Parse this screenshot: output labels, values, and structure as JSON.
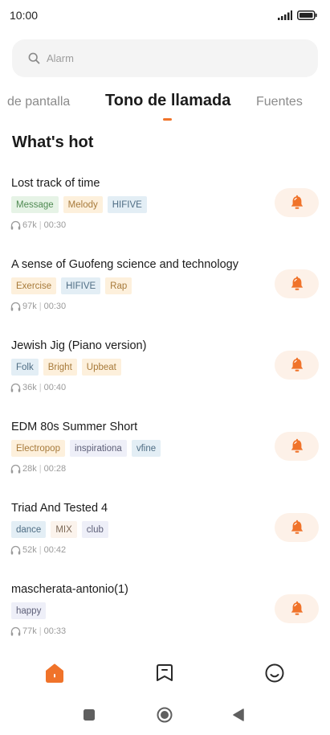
{
  "status_bar": {
    "time": "10:00"
  },
  "search": {
    "placeholder": "Alarm"
  },
  "tabs": [
    {
      "label": "de pantalla"
    },
    {
      "label": "Tono de llamada"
    },
    {
      "label": "Fuentes"
    }
  ],
  "section": {
    "title": "What's hot"
  },
  "colors": {
    "accent": "#f0732a",
    "ring_button_bg": "#fdf1e8"
  },
  "ringtones": [
    {
      "title": "Lost track of time",
      "tags": [
        "Message",
        "Melody",
        "HIFIVE"
      ],
      "plays": "67k",
      "duration": "00:30"
    },
    {
      "title": "A sense of Guofeng science and technology",
      "tags": [
        "Exercise",
        "HIFIVE",
        "Rap"
      ],
      "plays": "97k",
      "duration": "00:30"
    },
    {
      "title": "Jewish Jig (Piano version)",
      "tags": [
        "Folk",
        "Bright",
        "Upbeat"
      ],
      "plays": "36k",
      "duration": "00:40"
    },
    {
      "title": "EDM 80s Summer Short",
      "tags": [
        "Electropop",
        "inspirationa",
        "vfine"
      ],
      "plays": "28k",
      "duration": "00:28"
    },
    {
      "title": "Triad And Tested 4",
      "tags": [
        "dance",
        "MIX",
        "club"
      ],
      "plays": "52k",
      "duration": "00:42"
    },
    {
      "title": "mascherata-antonio(1)",
      "tags": [
        "happy"
      ],
      "plays": "77k",
      "duration": "00:33"
    }
  ],
  "bottom_nav": [
    {
      "icon": "home-icon",
      "active": true
    },
    {
      "icon": "bookmark-icon",
      "active": false
    },
    {
      "icon": "smiley-icon",
      "active": false
    }
  ],
  "system_nav": [
    {
      "icon": "recents-square-icon"
    },
    {
      "icon": "home-circle-icon"
    },
    {
      "icon": "back-triangle-icon"
    }
  ]
}
